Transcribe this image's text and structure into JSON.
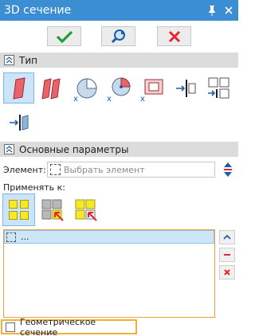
{
  "window": {
    "title": "3D сечение"
  },
  "toolbar": {
    "ok_icon": "check-icon",
    "preview_icon": "preview-icon",
    "cancel_icon": "close-icon"
  },
  "sections": {
    "type": {
      "title": "Тип"
    },
    "main": {
      "title": "Основные параметры"
    }
  },
  "element": {
    "label": "Элемент:",
    "placeholder": "Выбрать элемент"
  },
  "apply": {
    "label": "Применять к:"
  },
  "list": {
    "items": [
      "..."
    ]
  },
  "geometric": {
    "label": "Геометрическое сечение",
    "checked": false
  },
  "colors": {
    "titlebar": "#3c8ed3",
    "accent_orange": "#e8a33d",
    "green": "#1e9e3a",
    "red": "#e0282e",
    "selected": "#cce4f7"
  }
}
